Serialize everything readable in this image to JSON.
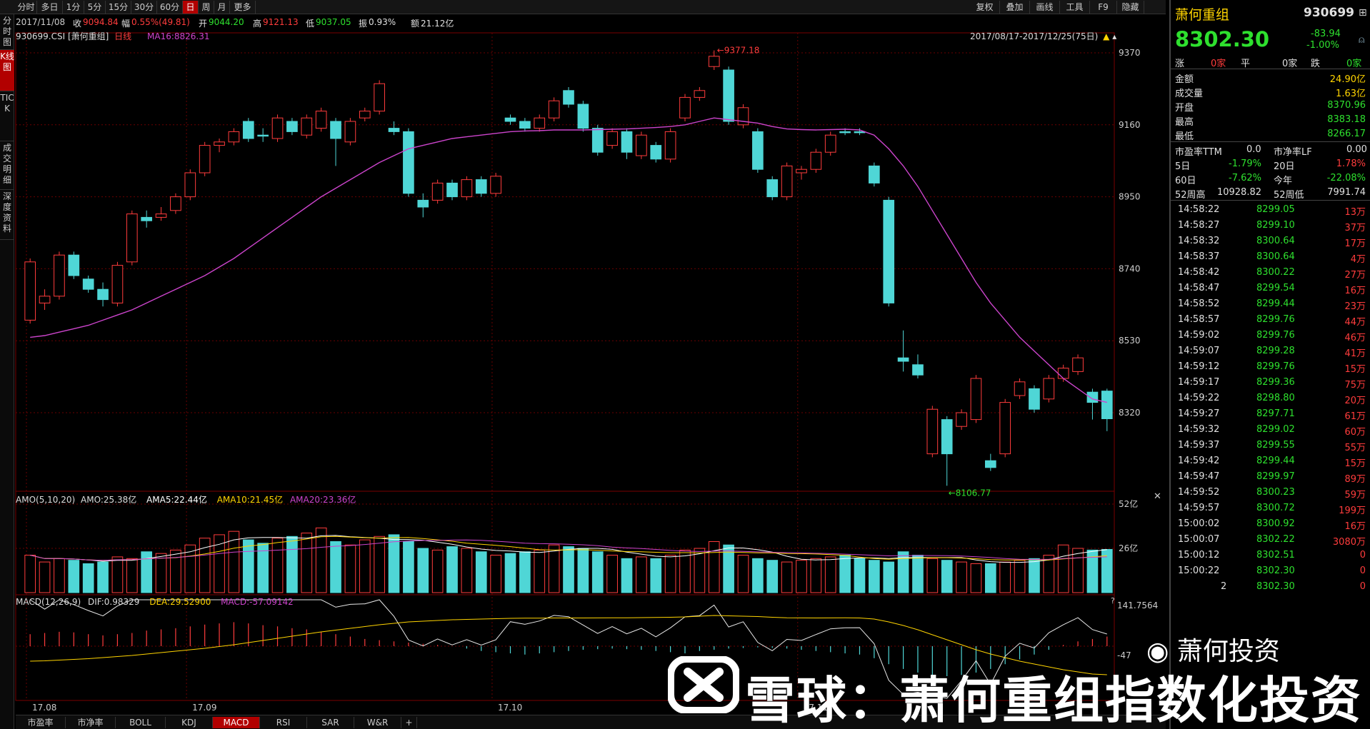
{
  "toolbar": {
    "periods": [
      "分时",
      "多日",
      "1分",
      "5分",
      "15分",
      "30分",
      "60分",
      "日",
      "周",
      "月",
      "更多"
    ],
    "active_period": "日",
    "right_buttons": [
      "复权",
      "叠加",
      "画线",
      "工具",
      "F9",
      "隐藏"
    ]
  },
  "infobar": {
    "date": "2017/11/08",
    "close_label": "收",
    "close_value": "9094.84",
    "change_label": "幅",
    "change_value": "0.55%(49.81)",
    "open_label": "开",
    "open_value": "9044.20",
    "high_label": "高",
    "high_value": "9121.13",
    "low_label": "低",
    "low_value": "9037.05",
    "amplitude_label": "振",
    "amplitude_value": "0.93%",
    "amount_label": "额",
    "amount_value": "21.12亿"
  },
  "leftbar": {
    "items": [
      "分时图",
      "K线图",
      "TICK",
      "成交明细",
      "深度资料"
    ],
    "active": "K线图"
  },
  "main_chart": {
    "symbol": "930699.CSI [萧何重组]",
    "kline_type": "日线",
    "ma_label": "MA16:8826.31",
    "date_range": "2017/08/17-2017/12/25(75日)",
    "high_marker": "9377.18",
    "low_marker": "8106.77",
    "price_ticks": [
      "9370",
      "9160",
      "8950",
      "8740",
      "8530",
      "8320"
    ],
    "x_ticks": [
      "17.08",
      "17.09",
      "17.10",
      "17.11"
    ]
  },
  "amo_panel": {
    "label": "AMO(5,10,20)",
    "amo": "AMO:25.38亿",
    "ama5": "AMA5:22.44亿",
    "ama10": "AMA10:21.45亿",
    "ama20": "AMA20:23.36亿",
    "ticks": [
      "52亿",
      "26亿"
    ]
  },
  "macd_panel": {
    "label": "MACD(12,26,9)",
    "dif": "DIF:0.98329",
    "dea": "DEA:29.52900",
    "macd": "MACD:-57.09142",
    "ticks": [
      "141.7564",
      "-47"
    ]
  },
  "bottom_tabs": [
    "市盈率",
    "市净率",
    "BOLL",
    "KDJ",
    "MACD",
    "RSI",
    "SAR",
    "W&R",
    "+"
  ],
  "active_bottom_tab": "MACD",
  "quote": {
    "name": "萧何重组",
    "code": "930699",
    "price": "8302.30",
    "change": "-83.94",
    "change_pct": "-1.00%",
    "up_label": "涨",
    "up_count": "0家",
    "flat_label": "平",
    "flat_count": "0家",
    "down_label": "跌",
    "down_count": "0家",
    "stats": [
      {
        "label": "金额",
        "value": "24.90亿"
      },
      {
        "label": "成交量",
        "value": "1.63亿"
      },
      {
        "label": "开盘",
        "value": "8370.96"
      },
      {
        "label": "最高",
        "value": "8383.18"
      },
      {
        "label": "最低",
        "value": "8266.17"
      }
    ],
    "pe_label": "市盈率TTM",
    "pe_value": "0.0",
    "pb_label": "市净率LF",
    "pb_value": "0.00",
    "perf": [
      {
        "l1": "5日",
        "v1": "-1.79%",
        "l2": "20日",
        "v2": "1.78%"
      },
      {
        "l1": "60日",
        "v1": "-7.62%",
        "l2": "今年",
        "v2": "-22.08%"
      },
      {
        "l1": "52周高",
        "v1": "10928.82",
        "l2": "52周低",
        "v2": "7991.74"
      }
    ]
  },
  "ticks_list": [
    {
      "time": "14:58:22",
      "price": "8299.05",
      "vol": "13万"
    },
    {
      "time": "14:58:27",
      "price": "8299.10",
      "vol": "37万"
    },
    {
      "time": "14:58:32",
      "price": "8300.64",
      "vol": "17万"
    },
    {
      "time": "14:58:37",
      "price": "8300.64",
      "vol": "4万"
    },
    {
      "time": "14:58:42",
      "price": "8300.22",
      "vol": "27万"
    },
    {
      "time": "14:58:47",
      "price": "8299.54",
      "vol": "16万"
    },
    {
      "time": "14:58:52",
      "price": "8299.44",
      "vol": "23万"
    },
    {
      "time": "14:58:57",
      "price": "8299.76",
      "vol": "44万"
    },
    {
      "time": "14:59:02",
      "price": "8299.76",
      "vol": "46万"
    },
    {
      "time": "14:59:07",
      "price": "8299.28",
      "vol": "41万"
    },
    {
      "time": "14:59:12",
      "price": "8299.76",
      "vol": "15万"
    },
    {
      "time": "14:59:17",
      "price": "8299.36",
      "vol": "75万"
    },
    {
      "time": "14:59:22",
      "price": "8298.80",
      "vol": "20万"
    },
    {
      "time": "14:59:27",
      "price": "8297.71",
      "vol": "61万"
    },
    {
      "time": "14:59:32",
      "price": "8299.02",
      "vol": "60万"
    },
    {
      "time": "14:59:37",
      "price": "8299.55",
      "vol": "55万"
    },
    {
      "time": "14:59:42",
      "price": "8299.44",
      "vol": "15万"
    },
    {
      "time": "14:59:47",
      "price": "8299.97",
      "vol": "89万"
    },
    {
      "time": "14:59:52",
      "price": "8300.23",
      "vol": "59万"
    },
    {
      "time": "14:59:57",
      "price": "8300.72",
      "vol": "199万"
    },
    {
      "time": "15:00:02",
      "price": "8300.92",
      "vol": "16万"
    },
    {
      "time": "15:00:07",
      "price": "8302.22",
      "vol": "3080万"
    },
    {
      "time": "15:00:12",
      "price": "8302.51",
      "vol": "0"
    },
    {
      "time": "15:00:22",
      "price": "8302.30",
      "vol": "0"
    },
    {
      "time": "2",
      "price": "8302.30",
      "vol": "0"
    }
  ],
  "watermark": {
    "text": "雪球：萧何重组指数化投资",
    "wechat": "萧何投资"
  },
  "colors": {
    "up": "#ff3c3c",
    "down": "#4fd6d6",
    "ma": "#cc44cc",
    "active_tab": "#b20000",
    "price_yellow": "#ffd400"
  },
  "chart_data": {
    "type": "candlestick",
    "ylim": [
      8106.77,
      9377.18
    ],
    "candles": [
      {
        "o": 8590,
        "c": 8760,
        "h": 8770,
        "l": 8580
      },
      {
        "o": 8640,
        "c": 8660,
        "h": 8680,
        "l": 8620
      },
      {
        "o": 8660,
        "c": 8780,
        "h": 8790,
        "l": 8650
      },
      {
        "o": 8780,
        "c": 8720,
        "h": 8790,
        "l": 8710
      },
      {
        "o": 8710,
        "c": 8680,
        "h": 8720,
        "l": 8670
      },
      {
        "o": 8680,
        "c": 8650,
        "h": 8700,
        "l": 8630
      },
      {
        "o": 8640,
        "c": 8750,
        "h": 8760,
        "l": 8630
      },
      {
        "o": 8760,
        "c": 8900,
        "h": 8910,
        "l": 8750
      },
      {
        "o": 8890,
        "c": 8880,
        "h": 8910,
        "l": 8860
      },
      {
        "o": 8890,
        "c": 8900,
        "h": 8920,
        "l": 8880
      },
      {
        "o": 8910,
        "c": 8950,
        "h": 8960,
        "l": 8900
      },
      {
        "o": 8950,
        "c": 9020,
        "h": 9030,
        "l": 8940
      },
      {
        "o": 9020,
        "c": 9100,
        "h": 9110,
        "l": 9010
      },
      {
        "o": 9100,
        "c": 9110,
        "h": 9120,
        "l": 9080
      },
      {
        "o": 9110,
        "c": 9140,
        "h": 9150,
        "l": 9100
      },
      {
        "o": 9170,
        "c": 9120,
        "h": 9180,
        "l": 9110
      },
      {
        "o": 9130,
        "c": 9130,
        "h": 9150,
        "l": 9110
      },
      {
        "o": 9120,
        "c": 9180,
        "h": 9190,
        "l": 9110
      },
      {
        "o": 9170,
        "c": 9140,
        "h": 9180,
        "l": 9130
      },
      {
        "o": 9130,
        "c": 9180,
        "h": 9190,
        "l": 9120
      },
      {
        "o": 9150,
        "c": 9200,
        "h": 9210,
        "l": 9140
      },
      {
        "o": 9170,
        "c": 9120,
        "h": 9180,
        "l": 9040
      },
      {
        "o": 9110,
        "c": 9170,
        "h": 9180,
        "l": 9100
      },
      {
        "o": 9180,
        "c": 9200,
        "h": 9210,
        "l": 9170
      },
      {
        "o": 9200,
        "c": 9280,
        "h": 9290,
        "l": 9190
      },
      {
        "o": 9150,
        "c": 9140,
        "h": 9170,
        "l": 9130
      },
      {
        "o": 9140,
        "c": 8960,
        "h": 9150,
        "l": 8950
      },
      {
        "o": 8940,
        "c": 8920,
        "h": 8960,
        "l": 8890
      },
      {
        "o": 8940,
        "c": 8990,
        "h": 9000,
        "l": 8930
      },
      {
        "o": 8990,
        "c": 8950,
        "h": 9000,
        "l": 8940
      },
      {
        "o": 8950,
        "c": 9000,
        "h": 9010,
        "l": 8940
      },
      {
        "o": 9000,
        "c": 8960,
        "h": 9010,
        "l": 8950
      },
      {
        "o": 8960,
        "c": 9010,
        "h": 9020,
        "l": 8950
      },
      {
        "o": 9180,
        "c": 9170,
        "h": 9190,
        "l": 9160
      },
      {
        "o": 9170,
        "c": 9150,
        "h": 9180,
        "l": 9140
      },
      {
        "o": 9150,
        "c": 9180,
        "h": 9190,
        "l": 9140
      },
      {
        "o": 9180,
        "c": 9230,
        "h": 9240,
        "l": 9170
      },
      {
        "o": 9260,
        "c": 9220,
        "h": 9270,
        "l": 9210
      },
      {
        "o": 9220,
        "c": 9150,
        "h": 9230,
        "l": 9140
      },
      {
        "o": 9150,
        "c": 9080,
        "h": 9160,
        "l": 9070
      },
      {
        "o": 9100,
        "c": 9140,
        "h": 9150,
        "l": 9090
      },
      {
        "o": 9140,
        "c": 9080,
        "h": 9150,
        "l": 9060
      },
      {
        "o": 9070,
        "c": 9130,
        "h": 9140,
        "l": 9060
      },
      {
        "o": 9100,
        "c": 9060,
        "h": 9110,
        "l": 9050
      },
      {
        "o": 9060,
        "c": 9140,
        "h": 9150,
        "l": 9050
      },
      {
        "o": 9180,
        "c": 9240,
        "h": 9250,
        "l": 9170
      },
      {
        "o": 9240,
        "c": 9260,
        "h": 9270,
        "l": 9230
      },
      {
        "o": 9330,
        "c": 9360,
        "h": 9377.18,
        "l": 9320
      },
      {
        "o": 9320,
        "c": 9170,
        "h": 9330,
        "l": 9160
      },
      {
        "o": 9160,
        "c": 9210,
        "h": 9220,
        "l": 9150
      },
      {
        "o": 9140,
        "c": 9030,
        "h": 9150,
        "l": 9020
      },
      {
        "o": 9000,
        "c": 8950,
        "h": 9010,
        "l": 8940
      },
      {
        "o": 8950,
        "c": 9040,
        "h": 9050,
        "l": 8940
      },
      {
        "o": 9020,
        "c": 9030,
        "h": 9040,
        "l": 9000
      },
      {
        "o": 9030,
        "c": 9080,
        "h": 9090,
        "l": 9020
      },
      {
        "o": 9080,
        "c": 9130,
        "h": 9140,
        "l": 9070
      },
      {
        "o": 9140,
        "c": 9140,
        "h": 9150,
        "l": 9130
      },
      {
        "o": 9140,
        "c": 9140,
        "h": 9150,
        "l": 9130
      },
      {
        "o": 9040,
        "c": 8990,
        "h": 9050,
        "l": 8980
      },
      {
        "o": 8940,
        "c": 8640,
        "h": 8950,
        "l": 8630
      },
      {
        "o": 8480,
        "c": 8470,
        "h": 8560,
        "l": 8440
      },
      {
        "o": 8460,
        "c": 8430,
        "h": 8490,
        "l": 8420
      },
      {
        "o": 8200,
        "c": 8330,
        "h": 8340,
        "l": 8190
      },
      {
        "o": 8300,
        "c": 8200,
        "h": 8310,
        "l": 8106.77
      },
      {
        "o": 8280,
        "c": 8320,
        "h": 8330,
        "l": 8270
      },
      {
        "o": 8300,
        "c": 8420,
        "h": 8430,
        "l": 8290
      },
      {
        "o": 8180,
        "c": 8160,
        "h": 8200,
        "l": 8150
      },
      {
        "o": 8200,
        "c": 8350,
        "h": 8360,
        "l": 8190
      },
      {
        "o": 8370,
        "c": 8410,
        "h": 8420,
        "l": 8360
      },
      {
        "o": 8390,
        "c": 8330,
        "h": 8400,
        "l": 8320
      },
      {
        "o": 8360,
        "c": 8420,
        "h": 8430,
        "l": 8350
      },
      {
        "o": 8420,
        "c": 8450,
        "h": 8460,
        "l": 8410
      },
      {
        "o": 8440,
        "c": 8480,
        "h": 8490,
        "l": 8430
      },
      {
        "o": 8380,
        "c": 8350,
        "h": 8390,
        "l": 8300
      },
      {
        "o": 8383.18,
        "c": 8302.3,
        "h": 8390,
        "l": 8266.17
      }
    ],
    "ma16": [
      8540,
      8545,
      8555,
      8565,
      8575,
      8590,
      8605,
      8620,
      8640,
      8660,
      8680,
      8700,
      8720,
      8745,
      8770,
      8800,
      8830,
      8860,
      8890,
      8920,
      8950,
      8975,
      9000,
      9025,
      9050,
      9070,
      9090,
      9100,
      9110,
      9120,
      9125,
      9130,
      9135,
      9140,
      9142,
      9143,
      9145,
      9145,
      9145,
      9146,
      9147,
      9148,
      9150,
      9152,
      9155,
      9160,
      9170,
      9180,
      9175,
      9170,
      9165,
      9155,
      9148,
      9146,
      9145,
      9146,
      9147,
      9145,
      9130,
      9090,
      9040,
      8980,
      8910,
      8840,
      8770,
      8700,
      8640,
      8590,
      8540,
      8500,
      8460,
      8420,
      8390,
      8360,
      8350
    ],
    "volumes": [
      22,
      18,
      20,
      19,
      17,
      18,
      21,
      20,
      24,
      23,
      25,
      28,
      32,
      34,
      36,
      31,
      29,
      32,
      33,
      35,
      38,
      30,
      28,
      31,
      33,
      34,
      30,
      26,
      25,
      27,
      26,
      24,
      22,
      23,
      24,
      25,
      28,
      27,
      26,
      24,
      22,
      20,
      21,
      20,
      22,
      25,
      26,
      30,
      28,
      22,
      20,
      19,
      18,
      19,
      20,
      21,
      22,
      20,
      19,
      18,
      24,
      22,
      20,
      19,
      18,
      17,
      17,
      18,
      19,
      20,
      22,
      28,
      26,
      25,
      25.38
    ],
    "macd_hist": [
      20,
      22,
      24,
      23,
      20,
      18,
      20,
      22,
      26,
      28,
      30,
      33,
      36,
      38,
      40,
      38,
      35,
      33,
      30,
      28,
      24,
      20,
      16,
      12,
      10,
      8,
      6,
      4,
      2,
      0,
      -4,
      -8,
      -10,
      -12,
      -14,
      -12,
      -10,
      -8,
      -6,
      -5,
      -4,
      -5,
      -6,
      -8,
      -10,
      -12,
      -8,
      -6,
      -4,
      -3,
      -2,
      -3,
      -4,
      -6,
      -8,
      -10,
      -12,
      -14,
      -20,
      -30,
      -38,
      -44,
      -48,
      -50,
      -48,
      -44,
      -38,
      -30,
      -22,
      -14,
      -6,
      2,
      8,
      12,
      16
    ]
  }
}
